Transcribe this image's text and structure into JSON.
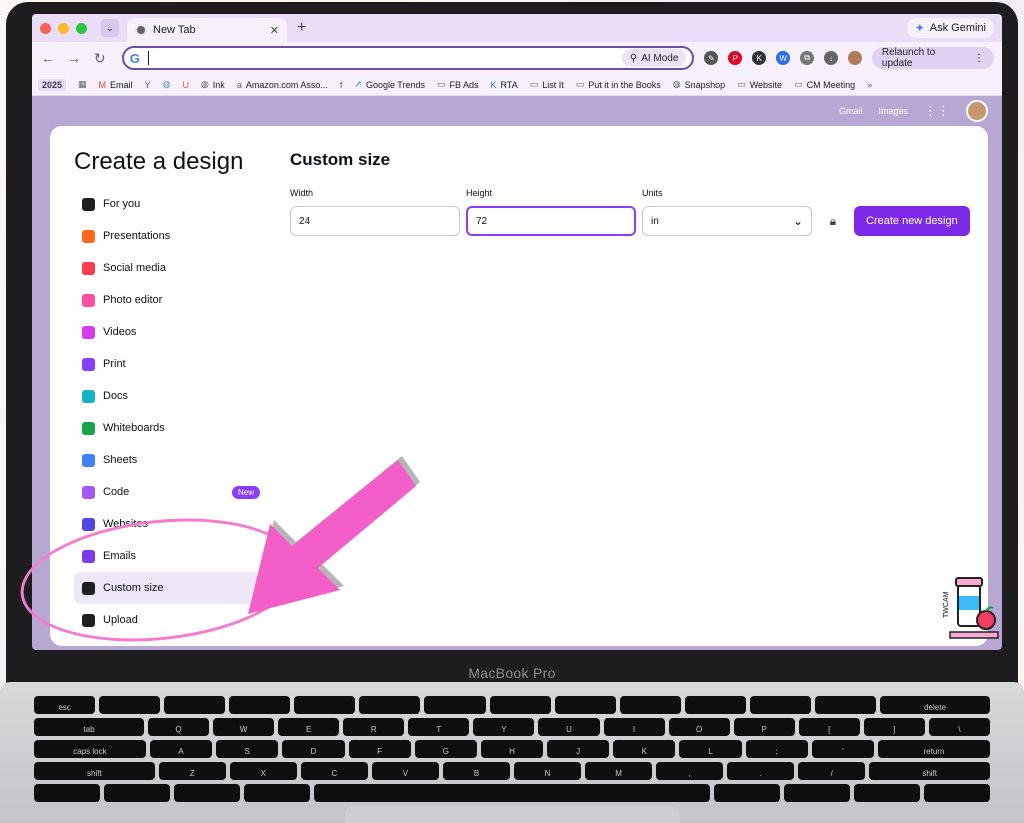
{
  "browser": {
    "tab_title": "New Tab",
    "gemini_label": "Ask Gemini",
    "ai_mode_label": "AI Mode",
    "relaunch_label": "Relaunch to update",
    "bookmarks": [
      "2025",
      "Email",
      "Ink",
      "Amazon.com Asso...",
      "Google Trends",
      "FB Ads",
      "RTA",
      "List It",
      "Put it in the Books",
      "Snapshop",
      "Website",
      "CM Meeting"
    ],
    "top_links": [
      "Gmail",
      "Images"
    ]
  },
  "modal": {
    "title": "Create a design",
    "sidebar": [
      {
        "label": "For you",
        "color": "#1f1f1f",
        "icon": "sparkle-icon"
      },
      {
        "label": "Presentations",
        "color": "#ff6a1a",
        "icon": "presentation-icon"
      },
      {
        "label": "Social media",
        "color": "#ff3b4e",
        "icon": "heart-icon"
      },
      {
        "label": "Photo editor",
        "color": "#ff4fa0",
        "icon": "camera-icon"
      },
      {
        "label": "Videos",
        "color": "#d93bf0",
        "icon": "video-icon"
      },
      {
        "label": "Print",
        "color": "#8b3dff",
        "icon": "printer-icon"
      },
      {
        "label": "Docs",
        "color": "#12b5c4",
        "icon": "doc-icon"
      },
      {
        "label": "Whiteboards",
        "color": "#16a34a",
        "icon": "whiteboard-icon"
      },
      {
        "label": "Sheets",
        "color": "#3b82f6",
        "icon": "sheet-icon"
      },
      {
        "label": "Code",
        "color": "#a855f7",
        "icon": "code-icon",
        "badge": "New"
      },
      {
        "label": "Websites",
        "color": "#4f46e5",
        "icon": "website-icon"
      },
      {
        "label": "Emails",
        "color": "#7c3aed",
        "icon": "email-icon"
      },
      {
        "label": "Custom size",
        "color": "#1f1f1f",
        "icon": "crop-icon",
        "active": true
      },
      {
        "label": "Upload",
        "color": "#1f1f1f",
        "icon": "upload-icon"
      }
    ],
    "main_title": "Custom size",
    "width_label": "Width",
    "width_value": "24",
    "height_label": "Height",
    "height_value": "72",
    "units_label": "Units",
    "units_value": "in",
    "create_button": "Create new design"
  },
  "laptop_label": "MacBook Pro",
  "stamp_text": "TWCAM",
  "keyboard": {
    "row1": [
      "esc",
      "",
      "",
      "",
      "",
      "",
      "",
      "",
      "",
      "",
      "",
      "",
      "",
      "delete"
    ],
    "row2": [
      "tab",
      "Q",
      "W",
      "E",
      "R",
      "T",
      "Y",
      "U",
      "I",
      "O",
      "P",
      "[",
      "]",
      "\\"
    ],
    "row3": [
      "caps lock",
      "A",
      "S",
      "D",
      "F",
      "G",
      "H",
      "J",
      "K",
      "L",
      ";",
      "'",
      "return"
    ],
    "row4": [
      "shift",
      "Z",
      "X",
      "C",
      "V",
      "B",
      "N",
      "M",
      ",",
      ".",
      "/",
      "shift"
    ]
  },
  "colors": {
    "accent": "#8b3dff",
    "button": "#7d2ae8",
    "highlight": "#f47bcf"
  }
}
